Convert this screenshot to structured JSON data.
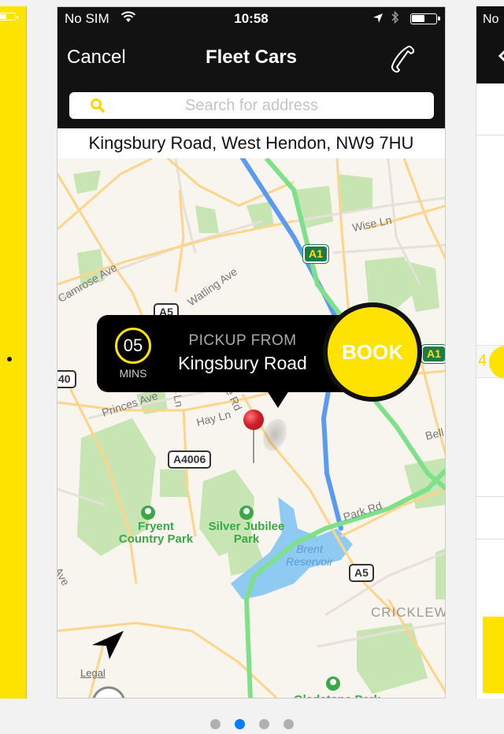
{
  "status_bar": {
    "carrier": "No SIM",
    "time": "10:58",
    "battery_level": 0.55
  },
  "nav": {
    "cancel_label": "Cancel",
    "title": "Fleet Cars",
    "call_icon": "phone-icon"
  },
  "search": {
    "placeholder": "Search for address",
    "value": "",
    "icon": "search-icon"
  },
  "address": "Kingsbury Road, West Hendon, NW9 7HU",
  "callout": {
    "eta_value": "05",
    "eta_unit": "MINS",
    "pickup_label": "PICKUP FROM",
    "pickup_place": "Kingsbury Road",
    "book_label": "BOOK"
  },
  "map": {
    "road_badges": [
      "A5",
      "A1",
      "A1",
      "A4006",
      "A5",
      "40"
    ],
    "street_labels": [
      "Wise Ln",
      "Camrose Ave",
      "Watling Ave",
      "Princes Ave",
      "Hay Ln",
      "Park Rd",
      "Bell",
      "Ave",
      "Ln",
      "re Rd"
    ],
    "parks": [
      "Fryent Country Park",
      "Silver Jubilee Park",
      "Gladstone Park"
    ],
    "water": "Brent Reservoir",
    "area": "CRICKLEWO",
    "legal_link": "Legal",
    "colors": {
      "land": "#f8f4ee",
      "park": "#c6e5b3",
      "water": "#8fcaf2",
      "major_road": "#fcd58b",
      "motorway_route": "#5a9af0",
      "trunk_route": "#7fe08a"
    }
  },
  "peek_right": {
    "carrier": "No",
    "number": "4"
  },
  "page_indicator": {
    "count": 4,
    "active_index": 1
  },
  "theme": {
    "accent": "#ffe300",
    "bar": "#121212",
    "pin": "#d21f2a",
    "page_dot_active": "#0a7aff"
  }
}
